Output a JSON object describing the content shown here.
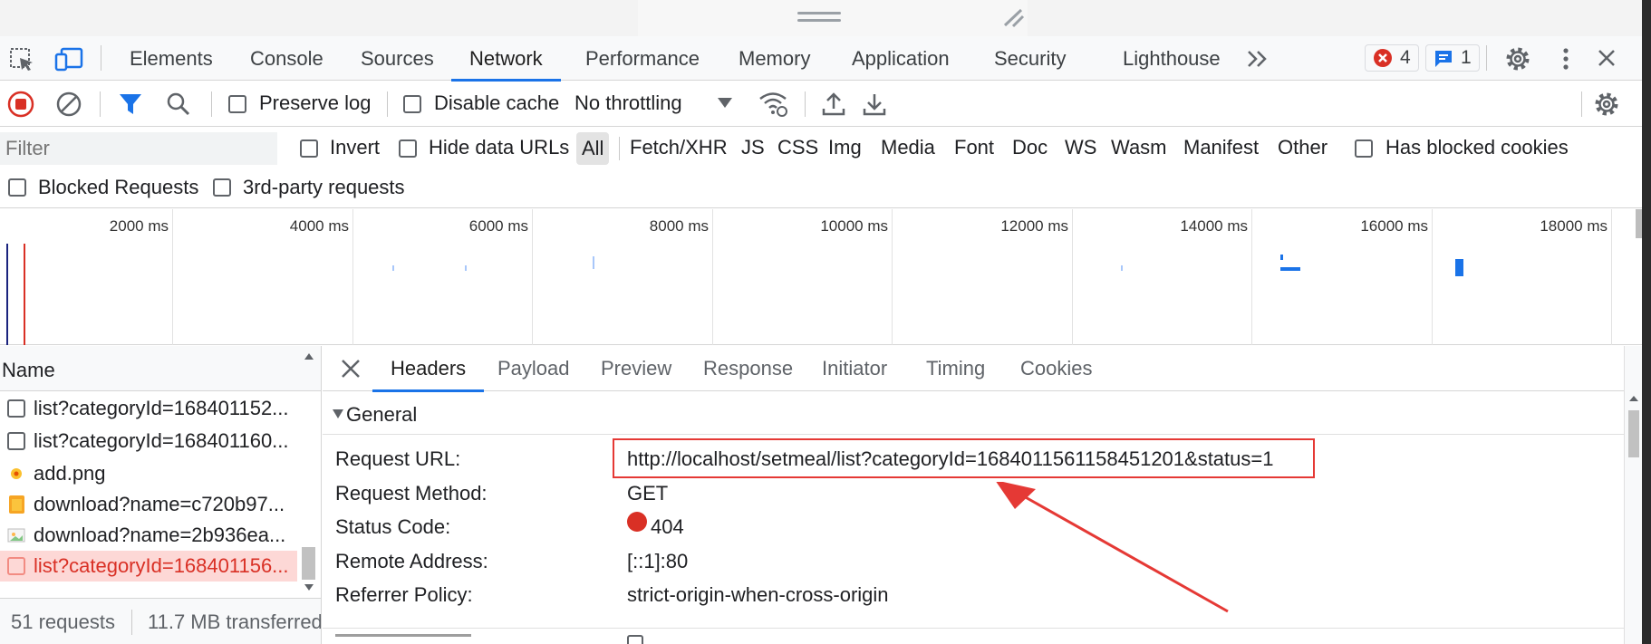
{
  "tabs": [
    "Elements",
    "Console",
    "Sources",
    "Network",
    "Performance",
    "Memory",
    "Application",
    "Security",
    "Lighthouse"
  ],
  "badges": {
    "errors": "4",
    "messages": "1"
  },
  "toolbar": {
    "preserve_log": "Preserve log",
    "disable_cache": "Disable cache",
    "throttling": "No throttling"
  },
  "filter": {
    "placeholder": "Filter",
    "invert": "Invert",
    "hide_data_urls": "Hide data URLs",
    "types": [
      "All",
      "Fetch/XHR",
      "JS",
      "CSS",
      "Img",
      "Media",
      "Font",
      "Doc",
      "WS",
      "Wasm",
      "Manifest",
      "Other"
    ],
    "has_blocked_cookies": "Has blocked cookies",
    "blocked_requests": "Blocked Requests",
    "third_party": "3rd-party requests"
  },
  "timeline": {
    "ticks": [
      "2000 ms",
      "4000 ms",
      "6000 ms",
      "8000 ms",
      "10000 ms",
      "12000 ms",
      "14000 ms",
      "16000 ms",
      "18000 ms"
    ]
  },
  "requests": {
    "header": "Name",
    "items": [
      {
        "name": "list?categoryId=168401152...",
        "type": "doc",
        "error": false
      },
      {
        "name": "list?categoryId=168401160...",
        "type": "doc",
        "error": false
      },
      {
        "name": "add.png",
        "type": "img-yellow",
        "error": false
      },
      {
        "name": "download?name=c720b97...",
        "type": "img-orange",
        "error": false
      },
      {
        "name": "download?name=2b936ea...",
        "type": "img-photo",
        "error": false
      },
      {
        "name": "list?categoryId=168401156...",
        "type": "doc",
        "error": true
      }
    ],
    "summary": "51 requests",
    "transferred": "11.7 MB transferred"
  },
  "details": {
    "tabs": [
      "Headers",
      "Payload",
      "Preview",
      "Response",
      "Initiator",
      "Timing",
      "Cookies"
    ],
    "section": "General",
    "rows": [
      {
        "key": "Request URL:",
        "value": "http://localhost/setmeal/list?categoryId=1684011561158451201&status=1"
      },
      {
        "key": "Request Method:",
        "value": "GET"
      },
      {
        "key": "Status Code:",
        "value": "404"
      },
      {
        "key": "Remote Address:",
        "value": "[::1]:80"
      },
      {
        "key": "Referrer Policy:",
        "value": "strict-origin-when-cross-origin"
      }
    ]
  },
  "colors": {
    "accent": "#1a73e8",
    "error": "#d93025",
    "annotation": "#e53935"
  }
}
